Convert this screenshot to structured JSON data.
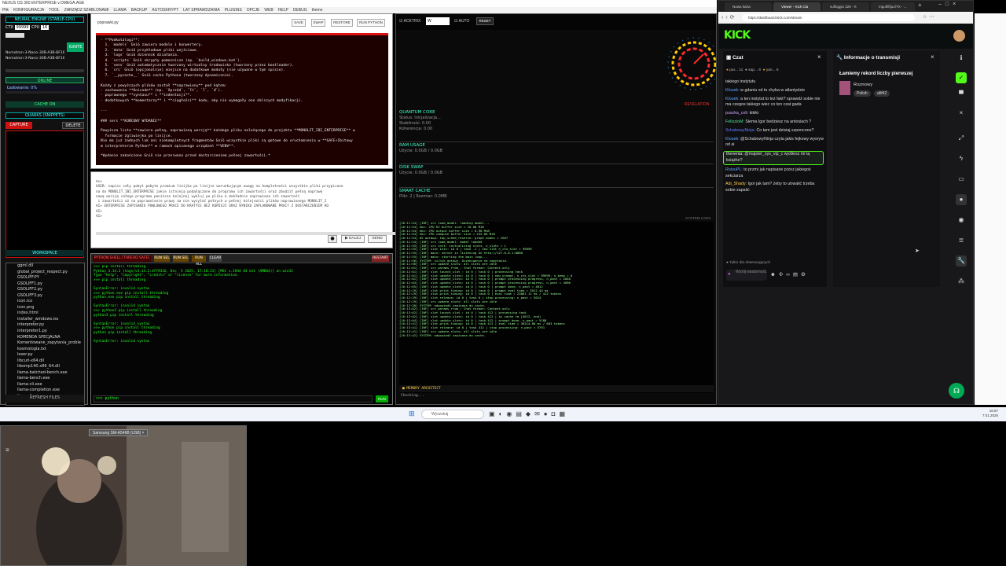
{
  "window": {
    "title": "NEXUS OS 360 ENTERPRISE v.OMEGA.AGE",
    "menu": [
      "Plik",
      "KONFIGURACJA",
      "TOOL",
      "ZARZĄDZ SZABLONAMI",
      "LLAMA",
      "BACKUP",
      "AUTOSKRYPT",
      "LAT SPRAWDZANIA",
      "PLUGINS",
      "OPCJE",
      "WEB",
      "HELP",
      "DEBUG",
      "theme"
    ]
  },
  "left": {
    "engine_title": "NEURAL ENGINE (STABLE-CPU)",
    "ctx_label": "CTX",
    "ctx_value": "99999",
    "cpu_label": "CPU",
    "cpu_value": "16",
    "model_lines": [
      "Nemotron-3-Nano-30B-A3B-BF16-0000",
      "Nemotron-3-Nano-30B-A3B-BF16-0000"
    ],
    "ignite": "IGNITE",
    "status_online": "ONLINE",
    "loading": "Ładowanie: 0%",
    "cache_on": "CACHE ON",
    "quarks_title": "QUARKS (SNIPPETS)",
    "capture": "CAPTURE",
    "delete": "DELETE",
    "workspace_title": "WORKSPACE",
    "files": [
      "ggml.dll",
      "global_project_respect.py",
      "GSOLIFF.PY",
      "GSOLIFF1.py",
      "GSOLIFF2.py",
      "GSOLIFF3.py",
      "icon.ico",
      "icon.png",
      "index.html",
      "installer_windows.iss",
      "interpreter.py",
      "interpreter1.py",
      "KOMENDA SPECJALNA",
      "Komentowane_zapytania_proble",
      "kosmologia.txt",
      "lexer.py",
      "libcurl-x64.dll",
      "libomp140.x86_64.dll",
      "llama-batched-bench.exe",
      "llama-bench.exe",
      "llama-cli.exe",
      "llama-completion.exe",
      "llama-finetune.exe"
    ],
    "refresh": "REFRESH FILES"
  },
  "editor": {
    "filename": "poprawki.py",
    "buttons": [
      "SAVE",
      "SWAP",
      "RESTORE",
      "RUN PYTHON"
    ],
    "text": "- **Podkatalogi**:\n  1. `models` Gniö zawiera modele i konwertery.\n  2. `data` Gniö przykładowe pliki wejściowe.\n  3. `logs` Gniö dziennik działania.\n  4. `scripts` Gniö skrypty pomocnicze (np. `build_windows.bat`).\n  5. `venv` Gniö automatycznie tworzony wirtualny środowisko (tworzony przez bootloader).\n  6. `src` Gniö (opcjonalnie) miejsce na dodatkowe moduły (nie używane w tym spisie).\n  7. `__pycache__` Gniö cache Pythona (tworzony dynamicznie).\n\nKażdy z powyższych plików został **naprawiony** pod kątem:\n- zachowania **Unicode** (np. `ěprzód`, `ľt`, `ĺ`, `ď`).\n- poprawnego **syntaxu** i **indentacji**.\n- dodatkowych **komentarzy** i **ciągłości** kodu, aby nie wymagały one dalszych modyfikacji.\n\n---\n\n### sers **KOŃCOWY WYDANIE**\n\nPowyższa lista **zawiera pełną, naprawioną wersję** każdego pliku należącego do projektu **MONOLIT_IBI_ENTERPRISE** w\n  formacie źgliwiejka po linijce.\nNie ma już żadnych luk ani niekompletnych fragmentów Gniö wszystkie pliki są gotowe do uruchomienia w **GAFE+Ibitowy\nm interpreterze Python** w ramach opisanego urządzeń **VENV**.\n\n*Wydanie zakończone Gniö nie przerwano przed dostarczeniem pełnej zawartości.*"
  },
  "input": {
    "text": "AI>\nUSER: napisz cały pobyt pobyte promium linijka po linijce warunkującym uwagę na kompletności wszystkie pliki przypisane\nna do MONOLIT_IBI_ENTERPRISE jakie istnieją podąłączone do programu ich zawartości oraz zbudzit pełną naprawę\nnową wersję całego programu poniższe kolejnej wykluj po pliku a dokładnie naprawiona ich zawartość\n i zawartości aż na poprawnienie prawy aa nie wysyłać pełnych w pełnej kolejności plików naprawionego MONOLIT_I\nAI> ENTERPRISE ZAPISANIU POWLOWEGO PRACE DO KRATYCE BEZ KOMISJI ORAZ WYNIKU ZAPLANOWANE PRACY Z DOSTARCZENIEM KO\nAI>\nAI>",
    "dalej": "DALEJ",
    "send": "SEND"
  },
  "shell": {
    "title": "PYTHON SHELL [THREAD SAFE]",
    "buttons": [
      "RUN SEL",
      "RUN SEL",
      "RUN ALL",
      "CLEAR"
    ],
    "restart": "RESTART",
    "text": ">>> pip install threading\nPython 3.14.2 (tags/v3.14.2:df79316, Dec  5 2025, 17:18:21) [MSC v.1944 64 bit (AMD64)] on win32\nType \"help\", \"copyright\", \"credits\" or \"license\" for more information.\n>>> pip install threading\n\nSyntaxError: invalid syntax\n>>> python.exe pip install threading\npython.exe pip install threading\n\nSyntaxError: invalid syntax\n>>> python3 pip install threading\npython3 pip install threading\n\nSyntaxError: invalid syntax\n>>> python pip install threading\npython pip install threading\n\nSyntaxError: invalid syntax",
    "prompt": ">>> python",
    "run": "RUN"
  },
  "mid": {
    "acktrix": "ACKTRIX",
    "acktrix_value": "W",
    "auto": "AUTO",
    "reset": "RESET",
    "revelation": "REVELATION",
    "quantum_title": "QUANTUM CORE",
    "quantum_status": "Status: Inicjalizacja...",
    "quantum_stab": "Stabilność: 0.00",
    "quantum_coh": "Koherencja: 0.00",
    "ram_title": "RAM USAGE",
    "ram_value": "Użycie: 0.0GB / 0.0GB",
    "swap_title": "DISK SWAP",
    "swap_value": "Użycie: 0.0GB / 0.0GB",
    "cache_title": "SMART CACHE",
    "cache_value": "Pliki: 2 | Rozmiar: 0.0MB",
    "syslogs": "SYSTEM LOGS",
    "logs": "[16:11:54] [INF] srv load_model: loading model...\n[16:11:54] ebc: CPU KV buffer size = 16.00 MiB\n[16:11:54] ebc: CPU output buffer size = 0.98 MiB\n[16:11:54] ebc: CPU compute buffer size = 232.00 MiB\n[16:11:54] OS warmup: tap_sched_reserve: graph nodes = 2567\n[16:11:54] [INF] srv load_model: model loaded\n[16:11:55] [INF] srv init: initializing slots, n_slots = 1\n[16:11:55] [INF] slot init: id 0 | task -1 | new slot n_ctx_slot = 99999\n[16:11:55] [INF] main: server is listening on http://127.0.0.1:8080\n[16:11:55] [INF] main: starting the main loop...\n[16:11:56] SYSTEM: silnik gotowy. Oczekiwanie na zapytania.\n[16:11:56] [INF] srv update_slots: all slots are idle\n[16:12:01] [INF] srv params_from_: Chat format: Content-only\n[16:12:01] [INF] slot launch_slot_: id 0 | task 0 | processing task\n[16:12:01] [INF] slot update_slots: id 0 | task 0 | new prompt, n_ctx_slot = 99999, n_keep = 0\n[16:12:01] [INF] slot update_slots: id 0 | task 0 | prompt processing progress, n_past = 2048\n[16:12:03] [INF] slot update_slots: id 0 | task 0 | prompt processing progress, n_past = 4096\n[16:12:05] [INF] slot update_slots: id 0 | task 0 | prompt done, n_past = 4612\n[16:12:29] [INF] slot print_timing: id 0 | task 0 | prompt eval time = 3912.44 ms\n[16:12:29] [INF] slot print_timing: id 0 | task 0 | eval time = 23867.11 ms / 412 tokens\n[16:12:29] [INF] slot release: id 0 | task 0 | stop processing: n_past = 5024\n[16:12:29] [INF] srv update_slots: all slots are idle\n[16:12:30] SYSTEM: odpowiedź zapisana do cache.\n[16:13:02] [INF] srv params_from_: Chat format: Content-only\n[16:13:02] [INF] slot launch_slot_: id 0 | task 412 | processing task\n[16:13:02] [INF] slot update_slots: id 0 | task 412 | kv cache rm [4612, end)\n[16:13:04] [INF] slot update_slots: id 0 | task 412 | prompt done, n_past = 5188\n[16:13:41] [INF] slot print_timing: id 0 | task 412 | eval time = 36214.80 ms / 603 tokens\n[16:13:41] [INF] slot release: id 0 | task 412 | stop processing: n_past = 5791\n[16:13:41] [INF] srv update_slots: all slots are idle\n[16:13:42] SYSTEM: odpowiedź zapisana do cache.",
    "memory_title": "MEMORY ARCHITECT",
    "memory_status": "Checking..."
  },
  "browser": {
    "tabs": [
      "Nowa karta",
      "Viewer - Kick Cla",
      "sufloggio 328 - K",
      "mgulf/tfjuo/TX - ..."
    ],
    "url": "https://dashboard.kick.com/stream",
    "brand": "KICK",
    "chat_title": "Czat",
    "top_users": [
      "par...",
      "sap...",
      "yan..."
    ],
    "top_counts": [
      "11",
      "8",
      "6"
    ],
    "messages": [
      {
        "user": "",
        "text": "takiego instytutu",
        "color": "#ddd"
      },
      {
        "user": "Klouek:",
        "text": "w gdaniu xd to chyba w atlantydzie",
        "color": "#5fa8ff"
      },
      {
        "user": "Klouek:",
        "text": "a ten instytut to też fakt? sprawdź sobie nie ma czegos takiego wiec co ten czat gada",
        "color": "#5fa8ff"
      },
      {
        "user": "puszka_coli:",
        "text": "kikiki",
        "color": "#d4a7ff"
      },
      {
        "user": "FelixzioM:",
        "text": "Siema Igor bedziesz na antosiach ?",
        "color": "#4fe08a"
      },
      {
        "user": "SchabowyNinja:",
        "text": "Co tam jest dzisiaj szponcone?",
        "color": "#5f7cff"
      },
      {
        "user": "Klouek:",
        "text": "@SchabowyNinja czyta jakis fejkowy wysryw od ai",
        "color": "#5fa8ff"
      },
      {
        "user": "theventa:",
        "text": "@majster_sys_vip_c wyśliesz mi tą książke?",
        "color": "#e6e6e6"
      },
      {
        "user": "RoiouPL:",
        "text": "to przmi jak napisane przez jakiegoś sekciarza",
        "color": "#5fa8ff"
      },
      {
        "user": "Adi_Shady:",
        "text": "Igor jak tam? żeby to utrwalić trzeba sobie zapalić",
        "color": "#ffcf4a"
      }
    ],
    "followers_only": "Tylko dla obserwujących",
    "send_placeholder": "Wyślij wiadomość",
    "info_title": "Informacje o transmisji",
    "stream_title": "Łamiemy rekord liczby pierwszej",
    "category": "Rozmowy",
    "tags": [
      "Polish",
      "afif42"
    ]
  },
  "taskbar": {
    "search": "Wyszukaj",
    "time": "16:57",
    "date": "7.01.2026"
  },
  "webcam": {
    "device": "Samsung SM-A546B [USB]"
  }
}
